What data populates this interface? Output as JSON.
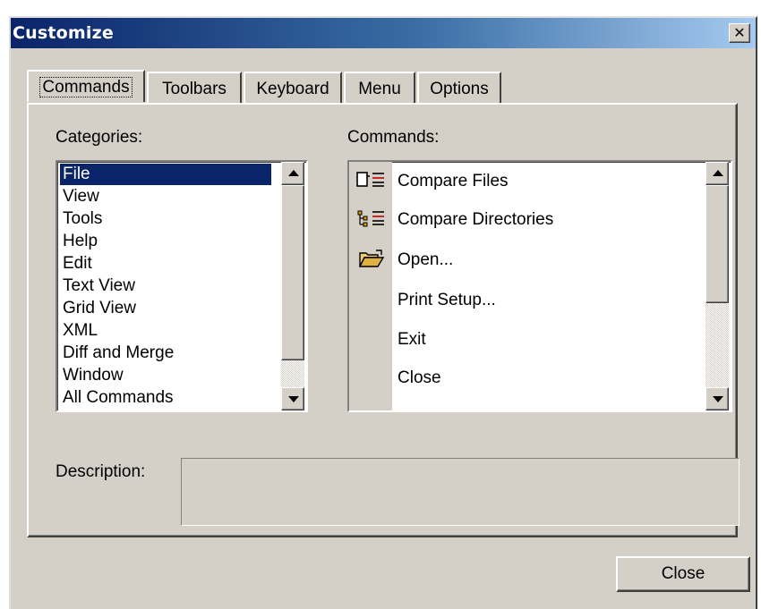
{
  "window": {
    "title": "Customize",
    "close_glyph": "✕"
  },
  "tabs": [
    {
      "label": "Commands",
      "active": true
    },
    {
      "label": "Toolbars",
      "active": false
    },
    {
      "label": "Keyboard",
      "active": false
    },
    {
      "label": "Menu",
      "active": false
    },
    {
      "label": "Options",
      "active": false
    }
  ],
  "categories": {
    "label": "Categories:",
    "items": [
      "File",
      "View",
      "Tools",
      "Help",
      "Edit",
      "Text View",
      "Grid View",
      "XML",
      "Diff and Merge",
      "Window",
      "All Commands"
    ],
    "selected": "File"
  },
  "commands": {
    "label": "Commands:",
    "items": [
      {
        "label": "Compare Files",
        "icon": "compare-files-icon"
      },
      {
        "label": "Compare Directories",
        "icon": "compare-directories-icon"
      },
      {
        "label": "Open...",
        "icon": "open-folder-icon"
      },
      {
        "label": "Print Setup...",
        "icon": ""
      },
      {
        "label": "Exit",
        "icon": ""
      },
      {
        "label": "Close",
        "icon": ""
      }
    ]
  },
  "description": {
    "label": "Description:",
    "value": ""
  },
  "footer": {
    "close_label": "Close"
  },
  "colors": {
    "selection": "#0a246a",
    "dialog": "#d4d0c8",
    "title_start": "#0a246a",
    "title_end": "#a6caf0"
  }
}
